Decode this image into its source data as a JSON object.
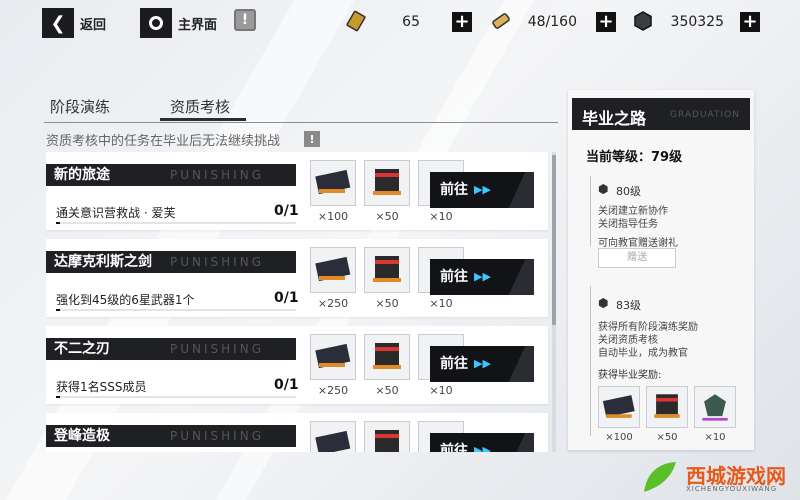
{
  "topbar": {
    "back_label": "返回",
    "home_label": "主界面",
    "resources": [
      {
        "icon": "gold-ticket-icon",
        "value": "65"
      },
      {
        "icon": "stamina-battery-icon",
        "value": "48/160"
      },
      {
        "icon": "coin-icon",
        "value": "350325"
      }
    ]
  },
  "tabs": [
    "阶段演练",
    "资质考核"
  ],
  "active_tab": 1,
  "notice": "资质考核中的任务在毕业后无法继续挑战",
  "tasks": [
    {
      "title": "新的旅途",
      "watermark": "PUNISHING",
      "desc": "通关意识营救战 · 爱芙",
      "progress": "0/1",
      "progress_fraction": 0.0,
      "rewards": [
        "×100",
        "×50",
        "×10"
      ],
      "go_label": "前往"
    },
    {
      "title": "达摩克利斯之剑",
      "watermark": "PUNISHING",
      "desc": "强化到45级的6星武器1个",
      "progress": "0/1",
      "progress_fraction": 0.0,
      "rewards": [
        "×250",
        "×50",
        "×10"
      ],
      "go_label": "前往"
    },
    {
      "title": "不二之刃",
      "watermark": "PUNISHING",
      "desc": "获得1名SSS成员",
      "progress": "0/1",
      "progress_fraction": 0.0,
      "rewards": [
        "×250",
        "×50",
        "×10"
      ],
      "go_label": "前往"
    },
    {
      "title": "登峰造极",
      "watermark": "PUNISHING",
      "desc": "",
      "progress": "",
      "progress_fraction": 0.0,
      "rewards": [
        "",
        "",
        ""
      ],
      "go_label": "前往"
    }
  ],
  "graduation": {
    "title": "毕业之路",
    "subtitle": "GRADUATION",
    "current_level": "当前等级：79级",
    "tiers": [
      {
        "name": "80级",
        "lines": [
          "关闭建立新协作",
          "关闭指导任务",
          "可向教官赠送谢礼"
        ],
        "button": "赠送"
      },
      {
        "name": "83级",
        "lines": [
          "获得所有阶段演练奖励",
          "关闭资质考核",
          "自动毕业，成为教官"
        ]
      }
    ],
    "reward_label": "获得毕业奖励:",
    "rewards": [
      "×100",
      "×50",
      "×10"
    ]
  },
  "watermark_logo": {
    "name": "西城游戏网",
    "sub": "XICHENGYOUXIWANG"
  }
}
